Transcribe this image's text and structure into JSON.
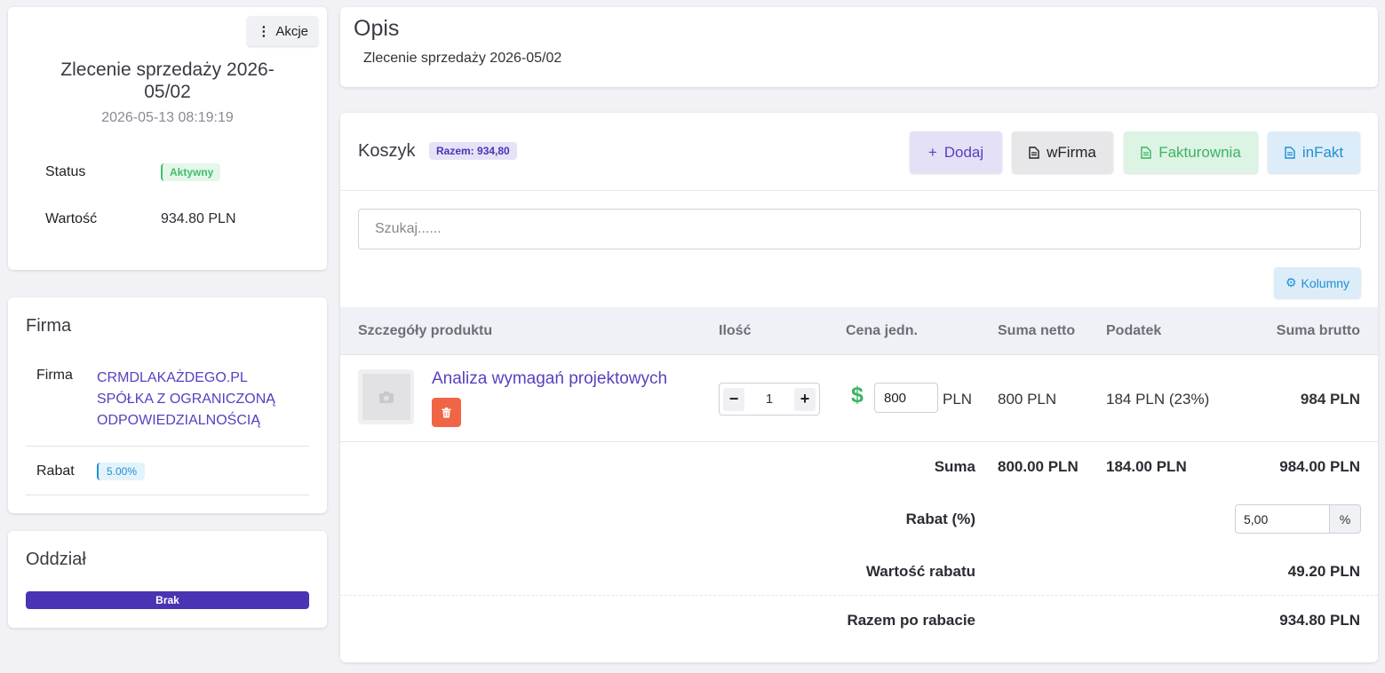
{
  "order": {
    "actions_label": "Akcje",
    "title": "Zlecenie sprzedaży 2026-05/02",
    "date": "2026-05-13 08:19:19",
    "status_label": "Status",
    "status_value": "Aktywny",
    "value_label": "Wartość",
    "value": "934.80 PLN"
  },
  "firma": {
    "heading": "Firma",
    "firma_label": "Firma",
    "firma_value": "CRMDLAKAŻDEGO.PL SPÓŁKA Z OGRANICZONĄ ODPOWIEDZIALNOŚCIĄ",
    "rabat_label": "Rabat",
    "rabat_value": "5.00%"
  },
  "oddzial": {
    "heading": "Oddział",
    "value": "Brak"
  },
  "opis": {
    "title": "Opis",
    "text": "Zlecenie sprzedaży 2026-05/02"
  },
  "koszyk": {
    "title": "Koszyk",
    "total_badge": "Razem: 934,80",
    "buttons": {
      "dodaj": "Dodaj",
      "wfirma": "wFirma",
      "fakturownia": "Fakturownia",
      "infakt": "inFakt"
    },
    "search_placeholder": "Szukaj......",
    "columns_button": "Kolumny",
    "headers": {
      "product": "Szczegóły produktu",
      "qty": "Ilość",
      "unit_price": "Cena jedn.",
      "net": "Suma netto",
      "tax": "Podatek",
      "gross": "Suma brutto"
    },
    "items": [
      {
        "name": "Analiza wymagań projektowych",
        "qty": "1",
        "unit_price": "800",
        "currency": "PLN",
        "net": "800 PLN",
        "tax": "184 PLN (23%)",
        "gross": "984 PLN"
      }
    ],
    "summary": {
      "sum_label": "Suma",
      "sum_net": "800.00 PLN",
      "sum_tax": "184.00 PLN",
      "sum_gross": "984.00 PLN",
      "rabat_label": "Rabat (%)",
      "rabat_value": "5,00",
      "rabat_suffix": "%",
      "rabat_amount_label": "Wartość rabatu",
      "rabat_amount": "49.20 PLN",
      "total_label": "Razem po rabacie",
      "total": "934.80 PLN"
    }
  },
  "colors": {
    "accent": "#5a3fc0",
    "success": "#3ab560",
    "info": "#1f8fd1",
    "danger": "#f06546",
    "bar": "#4b34b3"
  }
}
